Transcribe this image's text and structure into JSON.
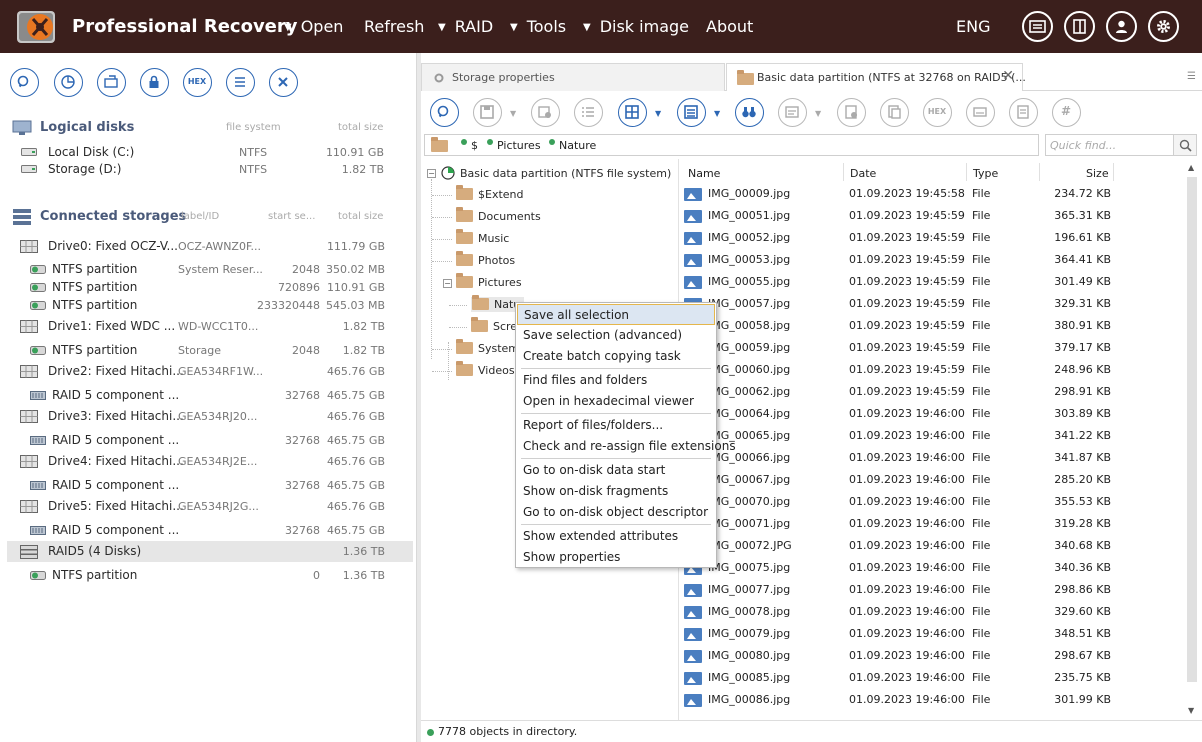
{
  "app": {
    "title": "Professional Recovery"
  },
  "menu": [
    {
      "label": "Open",
      "dropdown": true
    },
    {
      "label": "Refresh",
      "dropdown": false
    },
    {
      "label": "RAID",
      "dropdown": true
    },
    {
      "label": "Tools",
      "dropdown": true
    },
    {
      "label": "Disk image",
      "dropdown": true
    },
    {
      "label": "About",
      "dropdown": false
    }
  ],
  "lang": "ENG",
  "left": {
    "logical_heading": "Logical disks",
    "logical_cols": {
      "fs": "file system",
      "size": "total size"
    },
    "logical": [
      {
        "name": "Local Disk (C:)",
        "fs": "NTFS",
        "size": "110.91 GB"
      },
      {
        "name": "Storage (D:)",
        "fs": "NTFS",
        "size": "1.82 TB"
      }
    ],
    "storages_heading": "Connected storages",
    "storages_cols": {
      "label": "label/ID",
      "start": "start se...",
      "size": "total size"
    },
    "storages": [
      {
        "name": "Drive0: Fixed OCZ-V...",
        "label": "OCZ-AWNZ0F...",
        "start": "",
        "size": "111.79 GB",
        "kind": "drive",
        "indent": 0
      },
      {
        "name": "NTFS partition",
        "label": "System Reser...",
        "start": "2048",
        "size": "350.02 MB",
        "kind": "part",
        "indent": 1
      },
      {
        "name": "NTFS partition",
        "label": "",
        "start": "720896",
        "size": "110.91 GB",
        "kind": "part",
        "indent": 1
      },
      {
        "name": "NTFS partition",
        "label": "",
        "start": "233320448",
        "size": "545.03 MB",
        "kind": "part",
        "indent": 1
      },
      {
        "name": "Drive1: Fixed WDC ...",
        "label": "WD-WCC1T0...",
        "start": "",
        "size": "1.82 TB",
        "kind": "drive",
        "indent": 0
      },
      {
        "name": "NTFS partition",
        "label": "Storage",
        "start": "2048",
        "size": "1.82 TB",
        "kind": "part",
        "indent": 1
      },
      {
        "name": "Drive2: Fixed Hitachi...",
        "label": "GEA534RF1W...",
        "start": "",
        "size": "465.76 GB",
        "kind": "drive",
        "indent": 0
      },
      {
        "name": "RAID 5 component ...",
        "label": "",
        "start": "32768",
        "size": "465.75 GB",
        "kind": "raidc",
        "indent": 1
      },
      {
        "name": "Drive3: Fixed Hitachi...",
        "label": "GEA534RJ20...",
        "start": "",
        "size": "465.76 GB",
        "kind": "drive",
        "indent": 0
      },
      {
        "name": "RAID 5 component ...",
        "label": "",
        "start": "32768",
        "size": "465.75 GB",
        "kind": "raidc",
        "indent": 1
      },
      {
        "name": "Drive4: Fixed Hitachi...",
        "label": "GEA534RJ2E...",
        "start": "",
        "size": "465.76 GB",
        "kind": "drive",
        "indent": 0
      },
      {
        "name": "RAID 5 component ...",
        "label": "",
        "start": "32768",
        "size": "465.75 GB",
        "kind": "raidc",
        "indent": 1
      },
      {
        "name": "Drive5: Fixed Hitachi...",
        "label": "GEA534RJ2G...",
        "start": "",
        "size": "465.76 GB",
        "kind": "drive",
        "indent": 0
      },
      {
        "name": "RAID 5 component ...",
        "label": "",
        "start": "32768",
        "size": "465.75 GB",
        "kind": "raidc",
        "indent": 1
      },
      {
        "name": "RAID5 (4 Disks)",
        "label": "",
        "start": "",
        "size": "1.36 TB",
        "kind": "raid",
        "indent": 0,
        "selected": true
      },
      {
        "name": "NTFS partition",
        "label": "",
        "start": "0",
        "size": "1.36 TB",
        "kind": "part",
        "indent": 1
      }
    ]
  },
  "tabs": [
    {
      "label": "Storage properties",
      "active": false
    },
    {
      "label": "Basic data partition (NTFS at 32768 on RAID5 (...",
      "active": true
    }
  ],
  "path": [
    "$",
    "Pictures",
    "Nature"
  ],
  "quick_find_placeholder": "Quick find...",
  "tree": {
    "root": "Basic data partition (NTFS file system)",
    "folders": [
      "$Extend",
      "Documents",
      "Music",
      "Photos",
      "Pictures",
      "Nature",
      "Screenshots",
      "System",
      "Videos"
    ]
  },
  "tree_visible": {
    "nature": "Natu",
    "screenshots": "Scre"
  },
  "columns": {
    "name": "Name",
    "date": "Date",
    "type": "Type",
    "size": "Size"
  },
  "files": [
    {
      "name": "IMG_00009.jpg",
      "date": "01.09.2023 19:45:58",
      "type": "File",
      "size": "234.72 KB"
    },
    {
      "name": "IMG_00051.jpg",
      "date": "01.09.2023 19:45:59",
      "type": "File",
      "size": "365.31 KB"
    },
    {
      "name": "IMG_00052.jpg",
      "date": "01.09.2023 19:45:59",
      "type": "File",
      "size": "196.61 KB"
    },
    {
      "name": "IMG_00053.jpg",
      "date": "01.09.2023 19:45:59",
      "type": "File",
      "size": "364.41 KB"
    },
    {
      "name": "IMG_00055.jpg",
      "date": "01.09.2023 19:45:59",
      "type": "File",
      "size": "301.49 KB"
    },
    {
      "name": "IMG_00057.jpg",
      "date": "01.09.2023 19:45:59",
      "type": "File",
      "size": "329.31 KB"
    },
    {
      "name": "IMG_00058.jpg",
      "date": "01.09.2023 19:45:59",
      "type": "File",
      "size": "380.91 KB"
    },
    {
      "name": "IMG_00059.jpg",
      "date": "01.09.2023 19:45:59",
      "type": "File",
      "size": "379.17 KB"
    },
    {
      "name": "IMG_00060.jpg",
      "date": "01.09.2023 19:45:59",
      "type": "File",
      "size": "248.96 KB"
    },
    {
      "name": "IMG_00062.jpg",
      "date": "01.09.2023 19:45:59",
      "type": "File",
      "size": "298.91 KB"
    },
    {
      "name": "IMG_00064.jpg",
      "date": "01.09.2023 19:46:00",
      "type": "File",
      "size": "303.89 KB"
    },
    {
      "name": "IMG_00065.jpg",
      "date": "01.09.2023 19:46:00",
      "type": "File",
      "size": "341.22 KB"
    },
    {
      "name": "IMG_00066.jpg",
      "date": "01.09.2023 19:46:00",
      "type": "File",
      "size": "341.87 KB"
    },
    {
      "name": "IMG_00067.jpg",
      "date": "01.09.2023 19:46:00",
      "type": "File",
      "size": "285.20 KB"
    },
    {
      "name": "IMG_00070.jpg",
      "date": "01.09.2023 19:46:00",
      "type": "File",
      "size": "355.53 KB"
    },
    {
      "name": "IMG_00071.jpg",
      "date": "01.09.2023 19:46:00",
      "type": "File",
      "size": "319.28 KB"
    },
    {
      "name": "IMG_00072.JPG",
      "date": "01.09.2023 19:46:00",
      "type": "File",
      "size": "340.68 KB"
    },
    {
      "name": "IMG_00075.jpg",
      "date": "01.09.2023 19:46:00",
      "type": "File",
      "size": "340.36 KB"
    },
    {
      "name": "IMG_00077.jpg",
      "date": "01.09.2023 19:46:00",
      "type": "File",
      "size": "298.86 KB"
    },
    {
      "name": "IMG_00078.jpg",
      "date": "01.09.2023 19:46:00",
      "type": "File",
      "size": "329.60 KB"
    },
    {
      "name": "IMG_00079.jpg",
      "date": "01.09.2023 19:46:00",
      "type": "File",
      "size": "348.51 KB"
    },
    {
      "name": "IMG_00080.jpg",
      "date": "01.09.2023 19:46:00",
      "type": "File",
      "size": "298.67 KB"
    },
    {
      "name": "IMG_00085.jpg",
      "date": "01.09.2023 19:46:00",
      "type": "File",
      "size": "235.75 KB"
    },
    {
      "name": "IMG_00086.jpg",
      "date": "01.09.2023 19:46:00",
      "type": "File",
      "size": "301.99 KB"
    }
  ],
  "context_menu": [
    [
      "Save all selection",
      "Save selection (advanced)",
      "Create batch copying task"
    ],
    [
      "Find files and folders",
      "Open in hexadecimal viewer"
    ],
    [
      "Report of files/folders...",
      "Check and re-assign file extensions"
    ],
    [
      "Go to on-disk data start",
      "Show on-disk fragments",
      "Go to on-disk object descriptor"
    ],
    [
      "Show extended attributes",
      "Show properties"
    ]
  ],
  "status": "7778 objects in directory.",
  "hex_label": "HEX",
  "tree_hash_label": "#",
  "colors": {
    "topbar": "#3b1f1c",
    "accent": "#2d67b4",
    "menu_highlight": "#dce6f2",
    "menu_highlight_border": "#e4b64c"
  }
}
